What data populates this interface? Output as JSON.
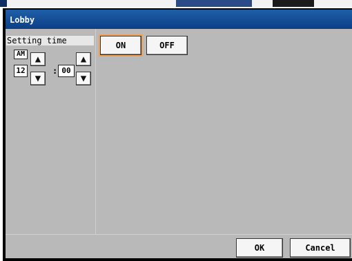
{
  "window": {
    "title": "Lobby"
  },
  "setting": {
    "label": "Setting time",
    "ampm": "AM",
    "hour": "12",
    "separator": ":",
    "minute": "00"
  },
  "toggle": {
    "on_label": "ON",
    "off_label": "OFF"
  },
  "footer": {
    "ok_label": "OK",
    "cancel_label": "Cancel"
  },
  "icons": {
    "up": "▲",
    "down": "▼"
  },
  "colors": {
    "title_bar": "#0b3f86",
    "panel_bg": "#b9b9b9",
    "active_outline": "#f2a155"
  }
}
